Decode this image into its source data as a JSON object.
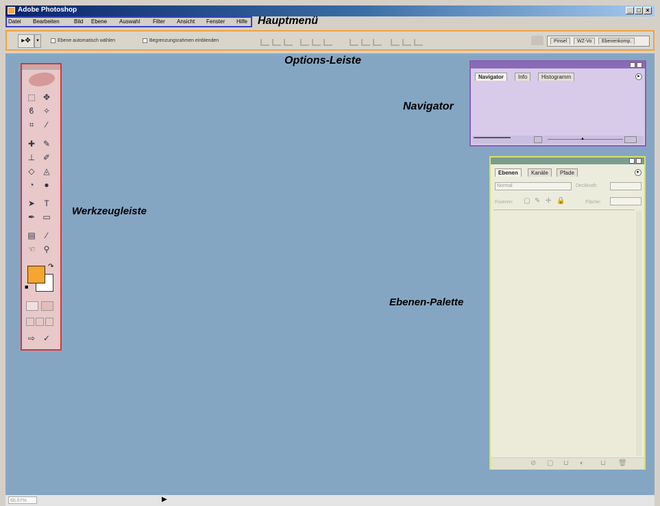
{
  "app": {
    "title": "Adobe Photoshop"
  },
  "menubar": {
    "items": [
      "Datei",
      "Bearbeiten",
      "Bild",
      "Ebene",
      "Auswahl",
      "Filter",
      "Ansicht",
      "Fenster",
      "Hilfe"
    ]
  },
  "options_bar": {
    "auto_select_label": "Ebene automatisch wählen",
    "bounding_box_label": "Begrenzungsrahmen einblenden",
    "palette_tabs": [
      "Pinsel",
      "WZ-Vo",
      "Ebenenkomp."
    ]
  },
  "callouts": {
    "hauptmenu": "Hauptmenü",
    "options": "Options-Leiste",
    "navigator": "Navigator",
    "toolbox": "Werkzeugleiste",
    "layers": "Ebenen-Palette"
  },
  "navigator_palette": {
    "tabs": [
      "Navigator",
      "Info",
      "Histogramm"
    ]
  },
  "layers_palette": {
    "tabs": [
      "Ebenen",
      "Kanäle",
      "Pfade"
    ],
    "blend_mode": "Normal",
    "opacity_label": "Deckkraft:",
    "lock_label": "Fixieren:",
    "fill_label": "Fläche:"
  },
  "colors": {
    "foreground": "#f5a530",
    "background": "#ffffff",
    "workspace": "#85a6c3"
  },
  "status": {
    "zoom": "66,67%"
  }
}
